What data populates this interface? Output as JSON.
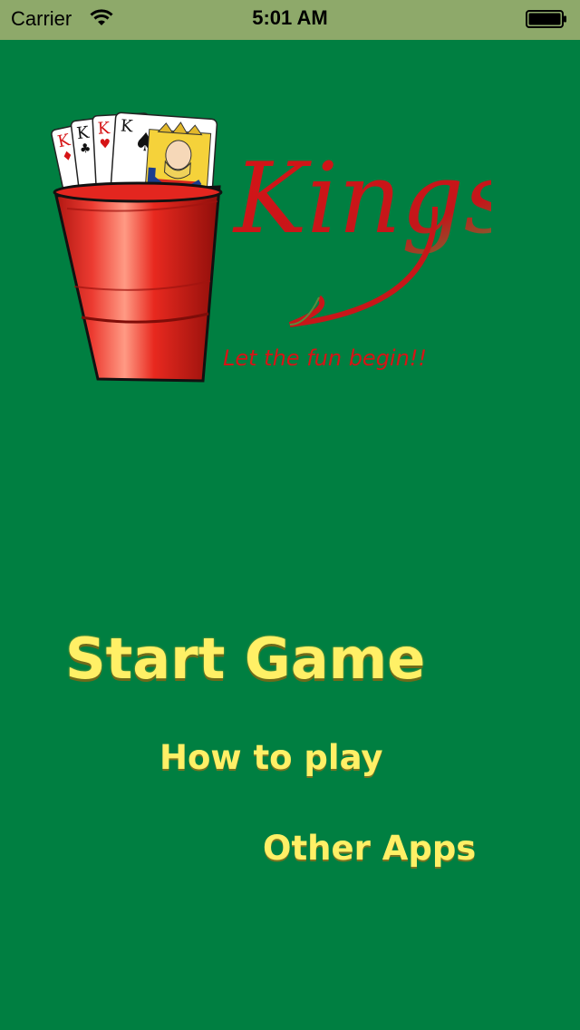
{
  "status_bar": {
    "carrier": "Carrier",
    "time": "5:01 AM",
    "wifi_icon": "wifi-icon",
    "battery_icon": "battery-icon"
  },
  "logo": {
    "title": "Kings",
    "tagline": "Let the fun begin!!",
    "card_ranks": [
      "K",
      "K",
      "K",
      "K"
    ],
    "card_suits": [
      "♦",
      "♣",
      "♥",
      "♠"
    ]
  },
  "menu": {
    "start_game": "Start Game",
    "how_to_play": "How to play",
    "other_apps": "Other Apps"
  },
  "colors": {
    "background": "#007f41",
    "status_bar": "#8ea96a",
    "menu_text": "#fff066",
    "cup_red": "#e3261f",
    "logo_red": "#d81416"
  }
}
